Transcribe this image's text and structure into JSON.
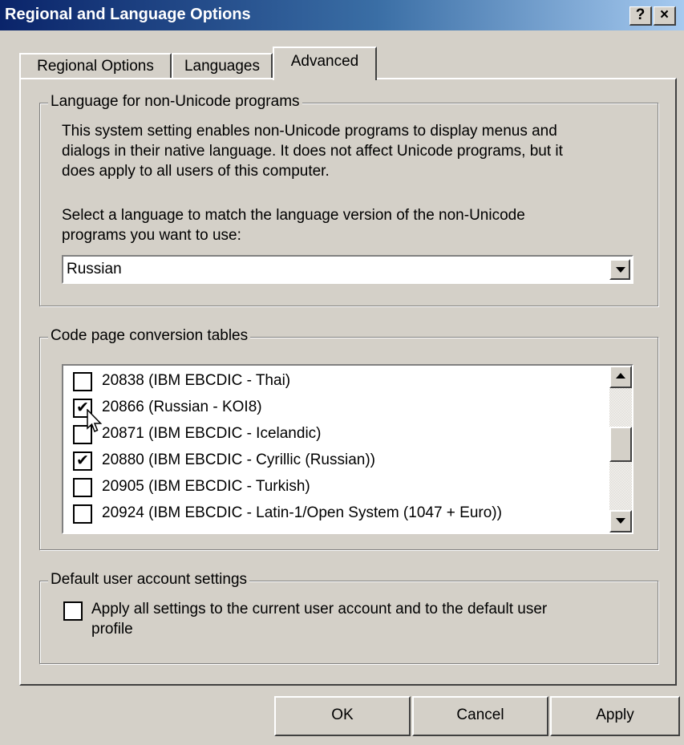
{
  "window": {
    "title": "Regional and Language Options",
    "help_label": "?",
    "close_label": "×"
  },
  "tabs": [
    {
      "label": "Regional Options",
      "active": false
    },
    {
      "label": "Languages",
      "active": false
    },
    {
      "label": "Advanced",
      "active": true
    }
  ],
  "non_unicode": {
    "legend": "Language for non-Unicode programs",
    "desc_lines": [
      "This system setting enables non-Unicode programs to display menus and",
      "dialogs in their native language. It does not affect Unicode programs, but it",
      "does apply to all users of this computer."
    ],
    "select_lines": [
      "Select a language to match the language version of the non-Unicode",
      "programs you want to use:"
    ],
    "selected_language": "Russian"
  },
  "code_pages": {
    "legend": "Code page conversion tables",
    "items": [
      {
        "label": "20838 (IBM EBCDIC - Thai)",
        "checked": false
      },
      {
        "label": "20866 (Russian - KOI8)",
        "checked": true
      },
      {
        "label": "20871 (IBM EBCDIC - Icelandic)",
        "checked": false
      },
      {
        "label": "20880 (IBM EBCDIC - Cyrillic (Russian))",
        "checked": true
      },
      {
        "label": "20905 (IBM EBCDIC - Turkish)",
        "checked": false
      },
      {
        "label": "20924 (IBM EBCDIC - Latin-1/Open System (1047 + Euro))",
        "checked": false
      }
    ]
  },
  "default_user": {
    "legend": "Default user account settings",
    "checkbox_lines": [
      "Apply all settings to the current user account and to the default user",
      "profile"
    ],
    "checked": false
  },
  "buttons": {
    "ok": "OK",
    "cancel": "Cancel",
    "apply": "Apply"
  },
  "colors": {
    "titlebar_start": "#0a246a",
    "titlebar_end": "#a6caf0",
    "face": "#d4d0c8"
  }
}
